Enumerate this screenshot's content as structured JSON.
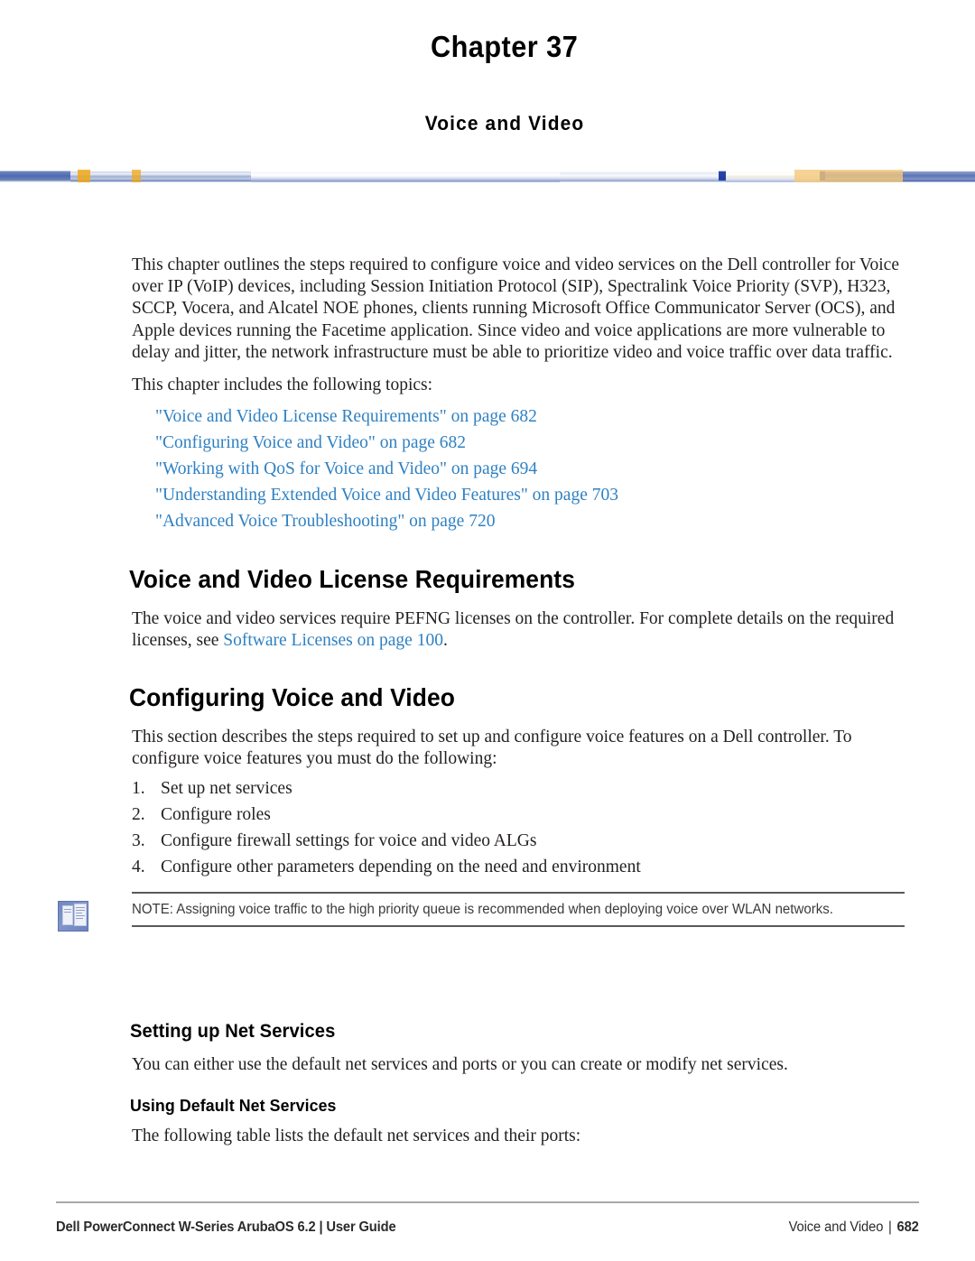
{
  "chapter": {
    "title": "Chapter 37",
    "subtitle": "Voice and Video"
  },
  "intro": {
    "paragraph": "This chapter outlines the steps required to configure voice and video services on the Dell  controller for Voice over IP (VoIP) devices, including Session Initiation Protocol (SIP), Spectralink Voice Priority (SVP), H323, SCCP, Vocera, and Alcatel NOE phones, clients running Microsoft Office Communicator Server (OCS), and Apple devices running the Facetime application. Since video and voice applications are more vulnerable to delay and jitter, the network infrastructure must be able to prioritize video and voice traffic over data traffic.",
    "topics_lead": "This chapter includes the following topics:",
    "topics": [
      "\"Voice and Video License Requirements\" on page 682",
      "\"Configuring Voice and Video\" on page 682",
      "\"Working with QoS for Voice and Video\" on page 694",
      "\"Understanding Extended Voice and Video Features\" on page 703",
      "\"Advanced Voice Troubleshooting\" on page 720"
    ]
  },
  "license_section": {
    "heading": "Voice and Video License Requirements",
    "text_before_link": "The voice and video services require PEFNG licenses on the controller. For complete details on the required licenses, see ",
    "link": "Software Licenses on page 100",
    "text_after_link": "."
  },
  "configuring_section": {
    "heading": "Configuring Voice and Video",
    "paragraph": "This section describes the steps required to set up and configure voice features on a  Dell  controller. To configure voice features you must do the following:",
    "steps": [
      {
        "num": "1.",
        "text": "Set up net services"
      },
      {
        "num": "2.",
        "text": "Configure roles"
      },
      {
        "num": "3.",
        "text": "Configure firewall settings for voice and video ALGs"
      },
      {
        "num": "4.",
        "text": "Configure other parameters depending on the need and environment"
      }
    ]
  },
  "note": {
    "text": "NOTE: Assigning voice traffic to the high priority queue is recommended when deploying voice over WLAN networks."
  },
  "net_services_section": {
    "heading": "Setting up Net Services",
    "paragraph": "You can either use the default net services and ports or you can create or modify net services.",
    "subheading": "Using Default Net Services",
    "sub_paragraph": "The following table lists the default net services and their ports:"
  },
  "footer": {
    "left": "Dell PowerConnect W-Series ArubaOS 6.2 | User Guide",
    "right_label": "Voice and Video",
    "separator": "|",
    "page_number": "682"
  },
  "colors": {
    "link": "#2f81c2",
    "text": "#231f20",
    "rule": "#58595b",
    "footer_rule": "#a7a9ac",
    "banner_blue": "#5f78b5"
  }
}
